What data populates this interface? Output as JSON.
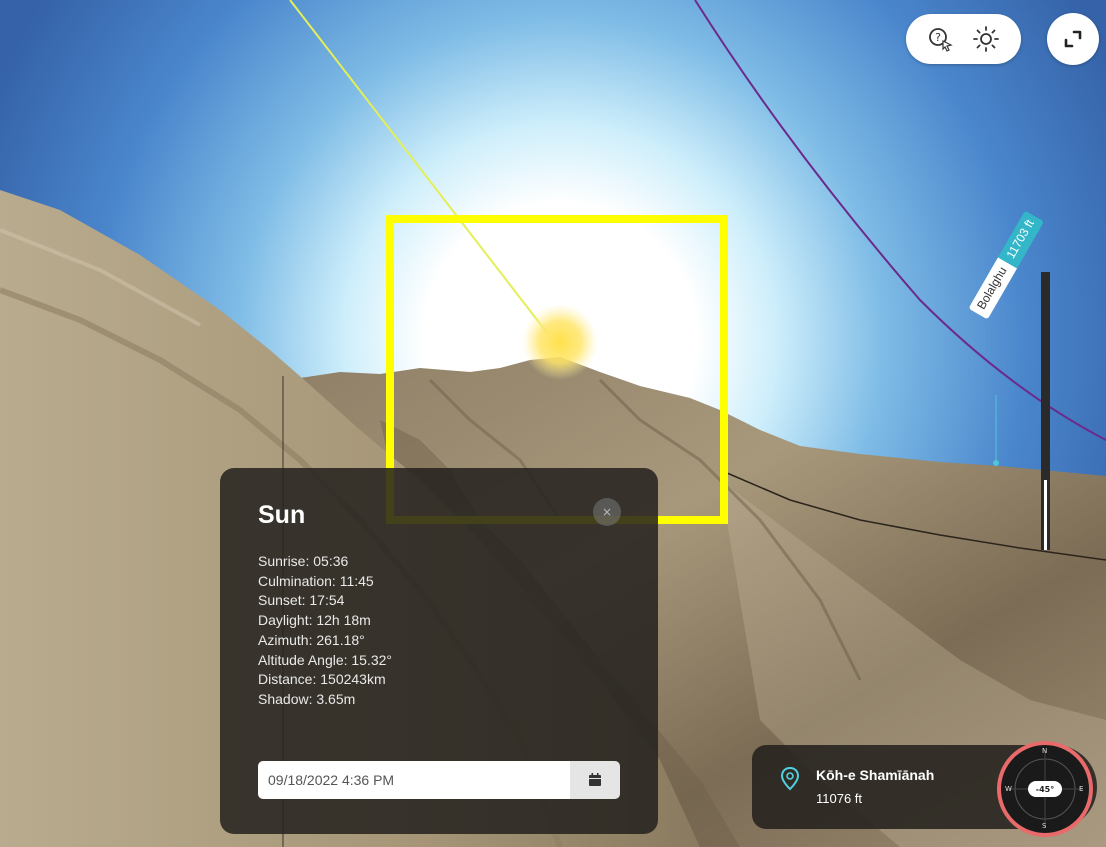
{
  "toolbar": {
    "icons": [
      "help-cursor-icon",
      "sun-brightness-icon",
      "fullscreen-icon"
    ]
  },
  "peak_label": {
    "name": "Bolalghu",
    "elevation": "11703 ft"
  },
  "sun_panel": {
    "title": "Sun",
    "close_label": "×",
    "info": {
      "sunrise": "Sunrise: 05:36",
      "culmination": "Culmination: 11:45",
      "sunset": "Sunset: 17:54",
      "daylight": "Daylight: 12h 18m",
      "azimuth": "Azimuth: 261.18°",
      "altitude_angle": "Altitude Angle: 15.32°",
      "distance": "Distance: 150243km",
      "shadow": "Shadow: 3.65m"
    },
    "datetime_value": "09/18/2022 4:36 PM",
    "calendar_icon": "calendar-icon"
  },
  "location": {
    "name": "Kōh-e Shamīānah",
    "altitude": "11076 ft",
    "pin_icon": "map-pin-icon"
  },
  "compass": {
    "directions": {
      "n": "N",
      "e": "E",
      "s": "S",
      "w": "W"
    },
    "heading_label": "-45°"
  },
  "colors": {
    "sky_top": "#3b6fb7",
    "highlight": "#ffff00",
    "panel_bg": "#24221e",
    "peak_badge": "#33b6c8",
    "compass_ring": "#e86a6a"
  }
}
